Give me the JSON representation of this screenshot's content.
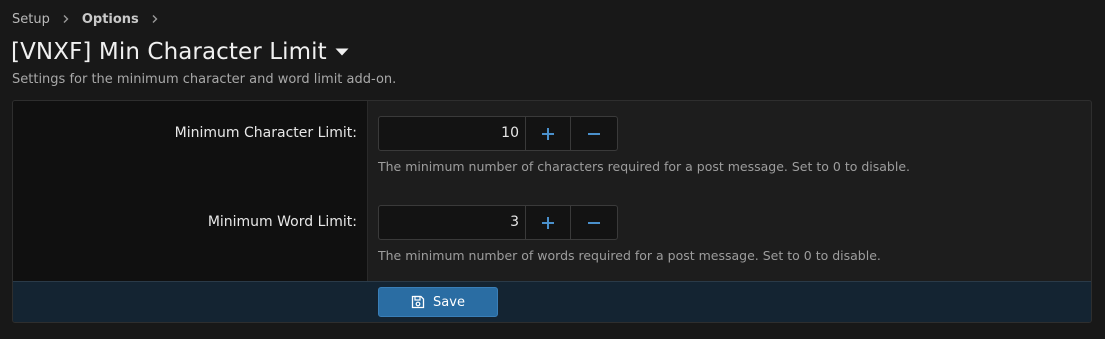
{
  "breadcrumb": {
    "items": [
      "Setup",
      "Options"
    ]
  },
  "header": {
    "title": "[VNXF] Min Character Limit",
    "description": "Settings for the minimum character and word limit add-on."
  },
  "options": [
    {
      "label": "Minimum Character Limit:",
      "value": "10",
      "hint": "The minimum number of characters required for a post message. Set to 0 to disable."
    },
    {
      "label": "Minimum Word Limit:",
      "value": "3",
      "hint": "The minimum number of words required for a post message. Set to 0 to disable."
    }
  ],
  "footer": {
    "save_label": "Save"
  },
  "colors": {
    "accent": "#2a6da3",
    "spinner_icon": "#4a90cc",
    "footer_bg": "#142432"
  },
  "icons": {
    "breadcrumb_separator": "chevron-right-icon",
    "title_menu": "caret-down-icon",
    "increment": "plus-icon",
    "decrement": "minus-icon",
    "save": "floppy-disk-icon"
  }
}
